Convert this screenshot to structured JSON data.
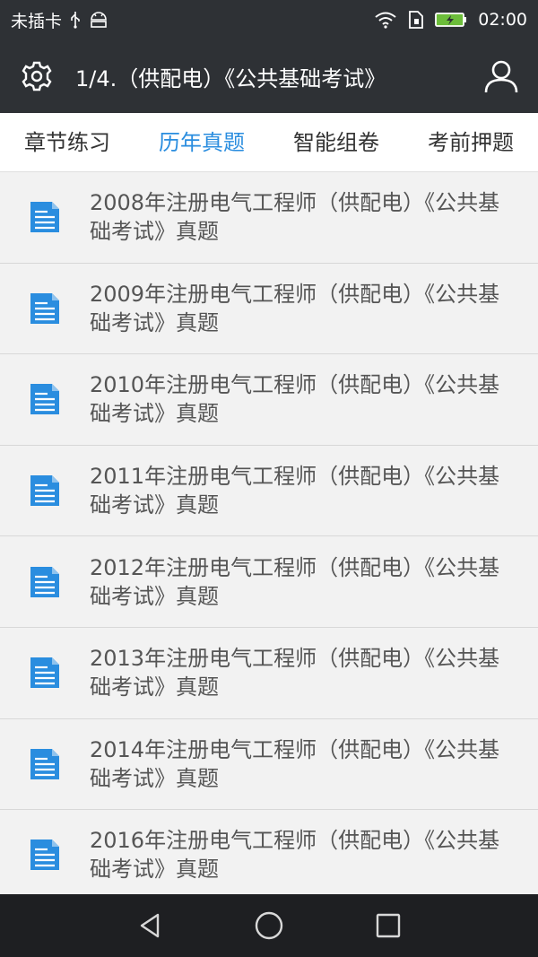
{
  "status_bar": {
    "carrier": "未插卡",
    "time": "02:00",
    "icons": [
      "usb-icon",
      "android-debug-icon",
      "wifi-icon",
      "sim-icon",
      "battery-charging-icon"
    ]
  },
  "app_bar": {
    "title": "1/4.（供配电）《公共基础考试》",
    "left_icon": "gear-icon",
    "right_icon": "user-icon"
  },
  "tabs": [
    {
      "label": "章节练习",
      "active": false
    },
    {
      "label": "历年真题",
      "active": true
    },
    {
      "label": "智能组卷",
      "active": false
    },
    {
      "label": "考前押题",
      "active": false
    }
  ],
  "list": {
    "items": [
      {
        "label": "2008年注册电气工程师（供配电）《公共基础考试》真题"
      },
      {
        "label": "2009年注册电气工程师（供配电）《公共基础考试》真题"
      },
      {
        "label": "2010年注册电气工程师（供配电）《公共基础考试》真题"
      },
      {
        "label": "2011年注册电气工程师（供配电）《公共基础考试》真题"
      },
      {
        "label": "2012年注册电气工程师（供配电）《公共基础考试》真题"
      },
      {
        "label": "2013年注册电气工程师（供配电）《公共基础考试》真题"
      },
      {
        "label": "2014年注册电气工程师（供配电）《公共基础考试》真题"
      },
      {
        "label": "2016年注册电气工程师（供配电）《公共基础考试》真题"
      }
    ],
    "item_icon": "document-icon"
  },
  "nav_bar": {
    "icons": [
      "back-icon",
      "home-icon",
      "recents-icon"
    ]
  },
  "colors": {
    "bar_bg": "#2e3135",
    "accent": "#2a8ddf",
    "list_bg": "#f2f2f2",
    "nav_bg": "#1e1f22"
  }
}
